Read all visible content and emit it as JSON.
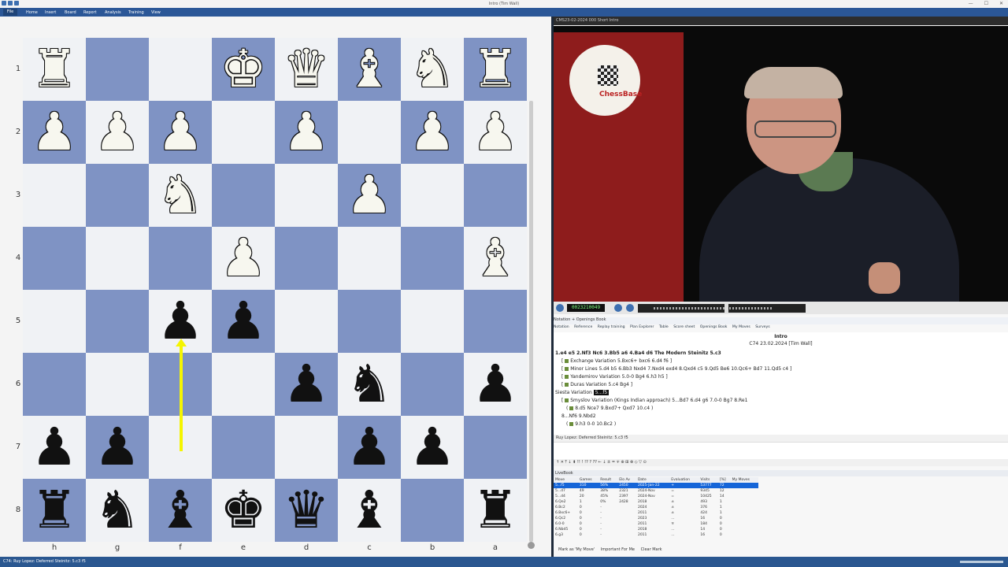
{
  "window": {
    "title": "Intro (Tim Wall)",
    "min": "—",
    "max": "☐",
    "close": "✕"
  },
  "ribbon": {
    "file": "File",
    "tabs": [
      "Home",
      "Insert",
      "Board",
      "Report",
      "Analysis",
      "Training",
      "View"
    ]
  },
  "board": {
    "ranks": [
      "1",
      "2",
      "3",
      "4",
      "5",
      "6",
      "7",
      "8"
    ],
    "files": [
      "h",
      "g",
      "f",
      "e",
      "d",
      "c",
      "b",
      "a"
    ],
    "pieces": [
      {
        "sq": "h1",
        "p": "R",
        "c": "w"
      },
      {
        "sq": "e1",
        "p": "K",
        "c": "w"
      },
      {
        "sq": "d1",
        "p": "Q",
        "c": "w"
      },
      {
        "sq": "c1",
        "p": "B",
        "c": "w"
      },
      {
        "sq": "b1",
        "p": "N",
        "c": "w"
      },
      {
        "sq": "a1",
        "p": "R",
        "c": "w"
      },
      {
        "sq": "h2",
        "p": "P",
        "c": "w"
      },
      {
        "sq": "g2",
        "p": "P",
        "c": "w"
      },
      {
        "sq": "f2",
        "p": "P",
        "c": "w"
      },
      {
        "sq": "d2",
        "p": "P",
        "c": "w"
      },
      {
        "sq": "b2",
        "p": "P",
        "c": "w"
      },
      {
        "sq": "a2",
        "p": "P",
        "c": "w"
      },
      {
        "sq": "f3",
        "p": "N",
        "c": "w"
      },
      {
        "sq": "c3",
        "p": "P",
        "c": "w"
      },
      {
        "sq": "e4",
        "p": "P",
        "c": "w"
      },
      {
        "sq": "a4",
        "p": "B",
        "c": "w"
      },
      {
        "sq": "f5",
        "p": "P",
        "c": "b"
      },
      {
        "sq": "e5",
        "p": "P",
        "c": "b"
      },
      {
        "sq": "d6",
        "p": "P",
        "c": "b"
      },
      {
        "sq": "c6",
        "p": "N",
        "c": "b"
      },
      {
        "sq": "a6",
        "p": "P",
        "c": "b"
      },
      {
        "sq": "h7",
        "p": "P",
        "c": "b"
      },
      {
        "sq": "g7",
        "p": "P",
        "c": "b"
      },
      {
        "sq": "c7",
        "p": "P",
        "c": "b"
      },
      {
        "sq": "b7",
        "p": "P",
        "c": "b"
      },
      {
        "sq": "h8",
        "p": "R",
        "c": "b"
      },
      {
        "sq": "g8",
        "p": "N",
        "c": "b"
      },
      {
        "sq": "f8",
        "p": "B",
        "c": "b"
      },
      {
        "sq": "e8",
        "p": "K",
        "c": "b"
      },
      {
        "sq": "d8",
        "p": "Q",
        "c": "b"
      },
      {
        "sq": "c8",
        "p": "B",
        "c": "b"
      },
      {
        "sq": "a8",
        "p": "R",
        "c": "b"
      }
    ],
    "arrow": {
      "from": "f7",
      "to": "f5",
      "color": "#f5f500"
    },
    "light_color": "#f0f2f5",
    "dark_color": "#7f93c4"
  },
  "video": {
    "title": "CMS23-02-2024 000 Short Intro",
    "logo_text": "ChessBase",
    "timecode": "0023210049"
  },
  "notation": {
    "tabs": "Notation + Openings Book",
    "subtabs": [
      "Notation",
      "Reference",
      "Replay training",
      "Plan Explorer",
      "Table",
      "Score sheet",
      "Openings Book",
      "My Moves",
      "Surveys"
    ],
    "game_title": "Intro",
    "game_info": "C74  23.02.2024 [Tim Wall]",
    "main_line": "1.e4  e5  2.Nf3  Nc6  3.Bb5  a6  4.Ba4  d6  The Modern Steinitz  5.c3",
    "variations": [
      "Exchange Variation  5.Bxc6+  bxc6  6.d4  f6 ]",
      "Minor Lines  5.d4  b5  6.Bb3  Nxd4  7.Nxd4  exd4  8.Qxd4  c5  9.Qd5  Be6  10.Qc6+  Bd7  11.Qd5  c4 ]",
      "Yandemirov Variation  5.0-0  Bg4  6.h3  h5 ]",
      "Duras Variation  5.c4  Bg4 ]"
    ],
    "siesta_label": "Siesta Variation",
    "siesta_move": "5...f5",
    "smyslov": "Smyslov Variation (Kings Indian approach)  5...Bd7  6.d4  g6  7.0-0  Bg7  8.Re1",
    "smyslov_sub": "8.d5  Nce7  9.Bxd7+  Qxd7  10.c4 )",
    "nf6_line": "8...Nf6  9.Nbd2",
    "nf6_sub": "9.h3  0-0  10.Bc2 )",
    "status": "Ruy Lopez: Deferred Steinitz: 5.c3 f5",
    "toolbar": "↑  ✕  ⤒  ↓  ⬍  !!  !  !?  ?  ??  ←  ↓  ±  =  ∓  ⊕  ⊞  ⊗  ◇  ▽  ⊙"
  },
  "livebook": {
    "title": "LiveBook",
    "headers": [
      "Move",
      "Games",
      "Result",
      "Elo Av",
      "Date",
      "Evaluation",
      "Visits",
      "[%]",
      "My Moves"
    ],
    "rows": [
      [
        "5...f5",
        "310",
        "56%",
        "2450",
        "2025-Jan-22",
        "+",
        "53777",
        "72",
        ""
      ],
      [
        "5...d7",
        "49",
        "38%",
        "2321",
        "2024-Nov",
        "=",
        "9345",
        "12",
        ""
      ],
      [
        "5...d4",
        "20",
        "45%",
        "2397",
        "2024-Nov",
        "=",
        "10425",
        "14",
        ""
      ],
      [
        "6.Qe2",
        "1",
        "0%",
        "2428",
        "2018",
        "±",
        "493",
        "1",
        ""
      ],
      [
        "6.Bc2",
        "0",
        "-",
        "",
        "2024",
        "±",
        "376",
        "1",
        ""
      ],
      [
        "6.Bxc6+",
        "0",
        "-",
        "",
        "2011",
        "±",
        "424",
        "1",
        ""
      ],
      [
        "6.Qc2",
        "0",
        "-",
        "",
        "2023",
        "...",
        "16",
        "0",
        ""
      ],
      [
        "6.0-0",
        "0",
        "-",
        "",
        "2011",
        "∓",
        "184",
        "0",
        ""
      ],
      [
        "6.Nbd5",
        "0",
        "-",
        "",
        "2018",
        "...",
        "14",
        "0",
        ""
      ],
      [
        "6.g3",
        "0",
        "-",
        "",
        "2011",
        "...",
        "16",
        "0",
        ""
      ]
    ],
    "footer": [
      "Mark as 'My Move'",
      "Important For Me",
      "Clear Mark"
    ]
  },
  "statusbar": {
    "left": "C74: Ruy Lopez: Deferred Steinitz: 5.c3 f5"
  }
}
